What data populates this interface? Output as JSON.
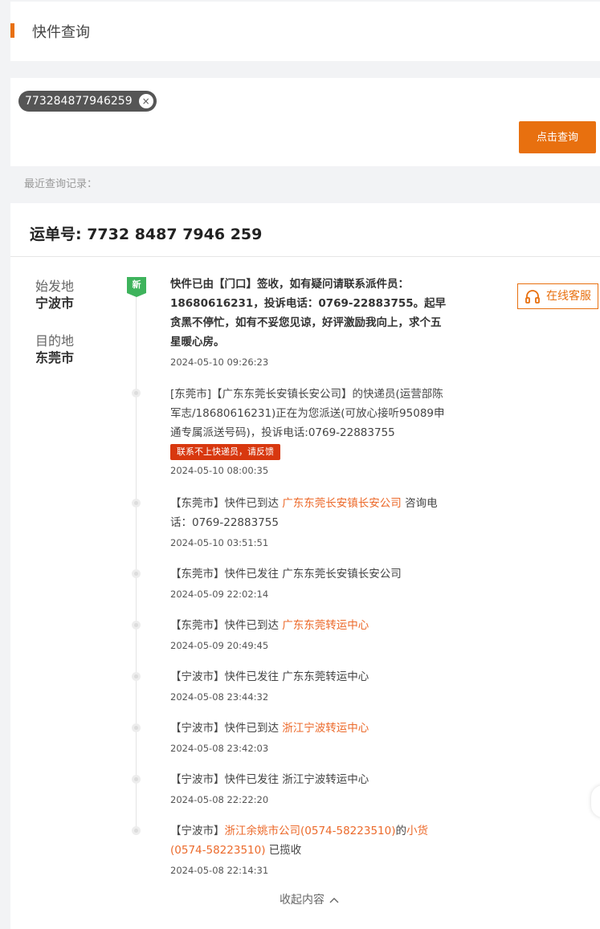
{
  "header": {
    "title": "快件查询"
  },
  "search": {
    "tracking_chip": "773284877946259",
    "chip_close": "×",
    "query_button": "点击查询"
  },
  "recent_label": "最近查询记录：",
  "waybill": {
    "label": "运单号: 7732 8487 7946 259"
  },
  "origin": {
    "label": "始发地",
    "value": "宁波市"
  },
  "destination": {
    "label": "目的地",
    "value": "东莞市"
  },
  "badge_new": "新",
  "service_button": "在线客服",
  "colors": {
    "accent": "#e8700f",
    "highlight": "#ec6a2b",
    "new_green": "#3eb35c",
    "alert_red": "#d8380f"
  },
  "events": [
    {
      "text": "快件已由【门口】签收，如有疑问请联系派件员：18680616231，投诉电话：0769-22883755。起早贪黑不停忙，如有不妥您见谅，好评激励我向上，求个五星暖心房。",
      "time": "2024-05-10 09:26:23"
    },
    {
      "text": "[东莞市]【广东东莞长安镇长安公司】的快递员(运营部陈军志/18680616231)正在为您派送(可放心接听95089申通专属派送号码)，投诉电话:0769-22883755",
      "action": "联系不上快递员，请反馈",
      "time": "2024-05-10 08:00:35"
    },
    {
      "pre": "【东莞市】快件已到达 ",
      "link": "广东东莞长安镇长安公司",
      "post": " 咨询电话：0769-22883755",
      "time": "2024-05-10 03:51:51"
    },
    {
      "pre": "【东莞市】快件已发往 广东东莞长安镇长安公司",
      "time": "2024-05-09 22:02:14"
    },
    {
      "pre": "【东莞市】快件已到达 ",
      "link": "广东东莞转运中心",
      "time": "2024-05-09 20:49:45"
    },
    {
      "pre": "【宁波市】快件已发往 广东东莞转运中心",
      "time": "2024-05-08 23:44:32"
    },
    {
      "pre": "【宁波市】快件已到达 ",
      "link": "浙江宁波转运中心",
      "time": "2024-05-08 23:42:03"
    },
    {
      "pre": "【宁波市】快件已发往 浙江宁波转运中心",
      "time": "2024-05-08 22:22:20"
    },
    {
      "pre": "【宁波市】",
      "link": "浙江余姚市公司(0574-58223510)",
      "mid": "的",
      "link2": "小货(0574-58223510)",
      "post": " 已揽收",
      "time": "2024-05-08 22:14:31"
    }
  ],
  "collapse_label": "收起内容"
}
